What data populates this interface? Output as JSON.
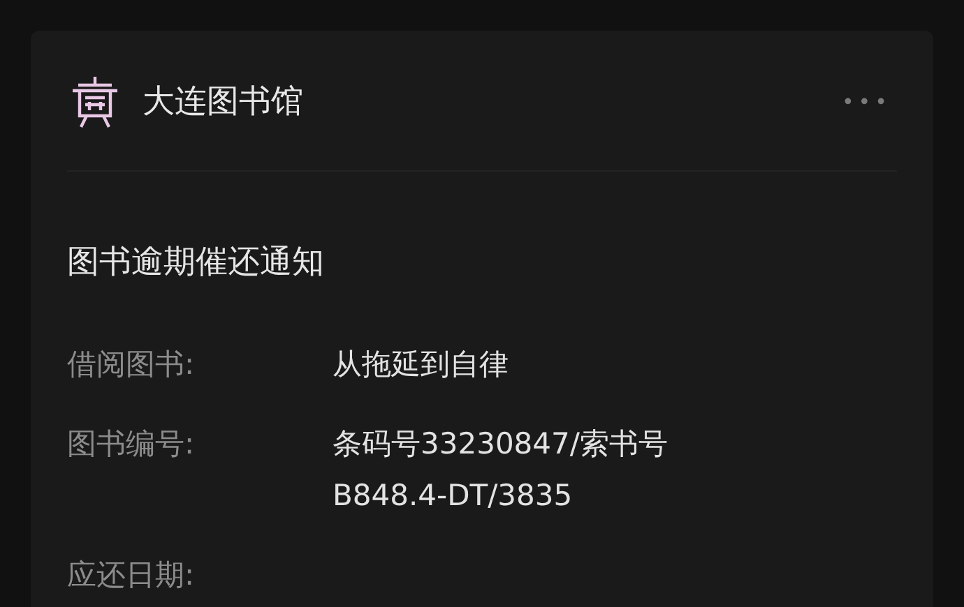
{
  "header": {
    "account_name": "大连图书馆",
    "menu": "•••"
  },
  "notice": {
    "title": "图书逾期催还通知",
    "fields": [
      {
        "label": "借阅图书:",
        "value": [
          "从拖延到自律"
        ]
      },
      {
        "label": "图书编号:",
        "value": [
          "条码号33230847/索书号",
          "B848.4-DT/3835"
        ]
      },
      {
        "label": "应还日期:"
      }
    ]
  }
}
